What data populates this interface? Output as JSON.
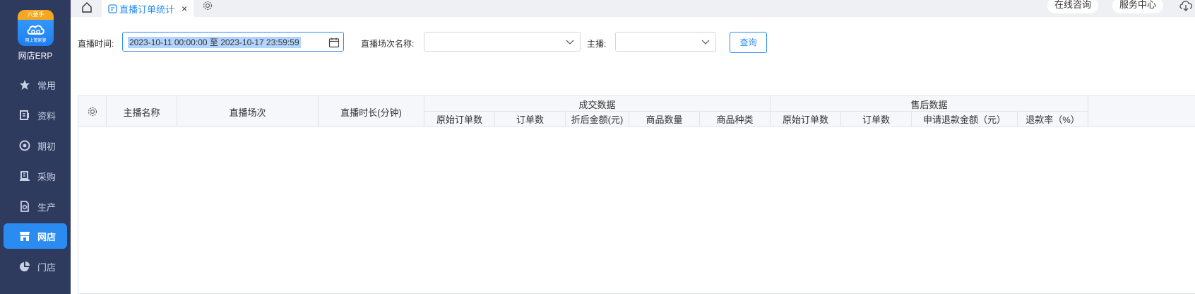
{
  "sidebar": {
    "logo_top": "六要手",
    "logo_sub": "网上管家婆",
    "app_name": "网店ERP",
    "items": [
      {
        "label": "常用",
        "icon": "star-icon",
        "active": false
      },
      {
        "label": "资料",
        "icon": "document-icon",
        "active": false
      },
      {
        "label": "期初",
        "icon": "target-icon",
        "active": false
      },
      {
        "label": "采购",
        "icon": "purchase-icon",
        "active": false
      },
      {
        "label": "生产",
        "icon": "production-icon",
        "active": false
      },
      {
        "label": "网店",
        "icon": "store-icon",
        "active": true
      },
      {
        "label": "门店",
        "icon": "pie-chart-icon",
        "active": false
      }
    ]
  },
  "tabs": {
    "active_label": "直播订单统计",
    "close_glyph": "×"
  },
  "header_buttons": {
    "consult": "在线咨询",
    "service": "服务中心"
  },
  "filters": {
    "date_label": "直播时间:",
    "date_value": "2023-10-11 00:00:00   至   2023-10-17 23:59:59",
    "session_label": "直播场次名称:",
    "session_value": "",
    "anchor_label": "主播:",
    "anchor_value": "",
    "query_label": "查询"
  },
  "table": {
    "columns": {
      "anchor_name": "主播名称",
      "session": "直播场次",
      "duration": "直播时长(分钟)",
      "deal_group": "成交数据",
      "aftersale_group": "售后数据"
    },
    "deal_sub": [
      "原始订单数",
      "订单数",
      "折后金额(元)",
      "商品数量",
      "商品种类"
    ],
    "aftersale_sub": [
      "原始订单数",
      "订单数",
      "申请退款金额（元）",
      "退款率（%）"
    ],
    "rows": []
  },
  "colors": {
    "sidebar_bg": "#2f3a5f",
    "accent": "#2a8cf0"
  }
}
